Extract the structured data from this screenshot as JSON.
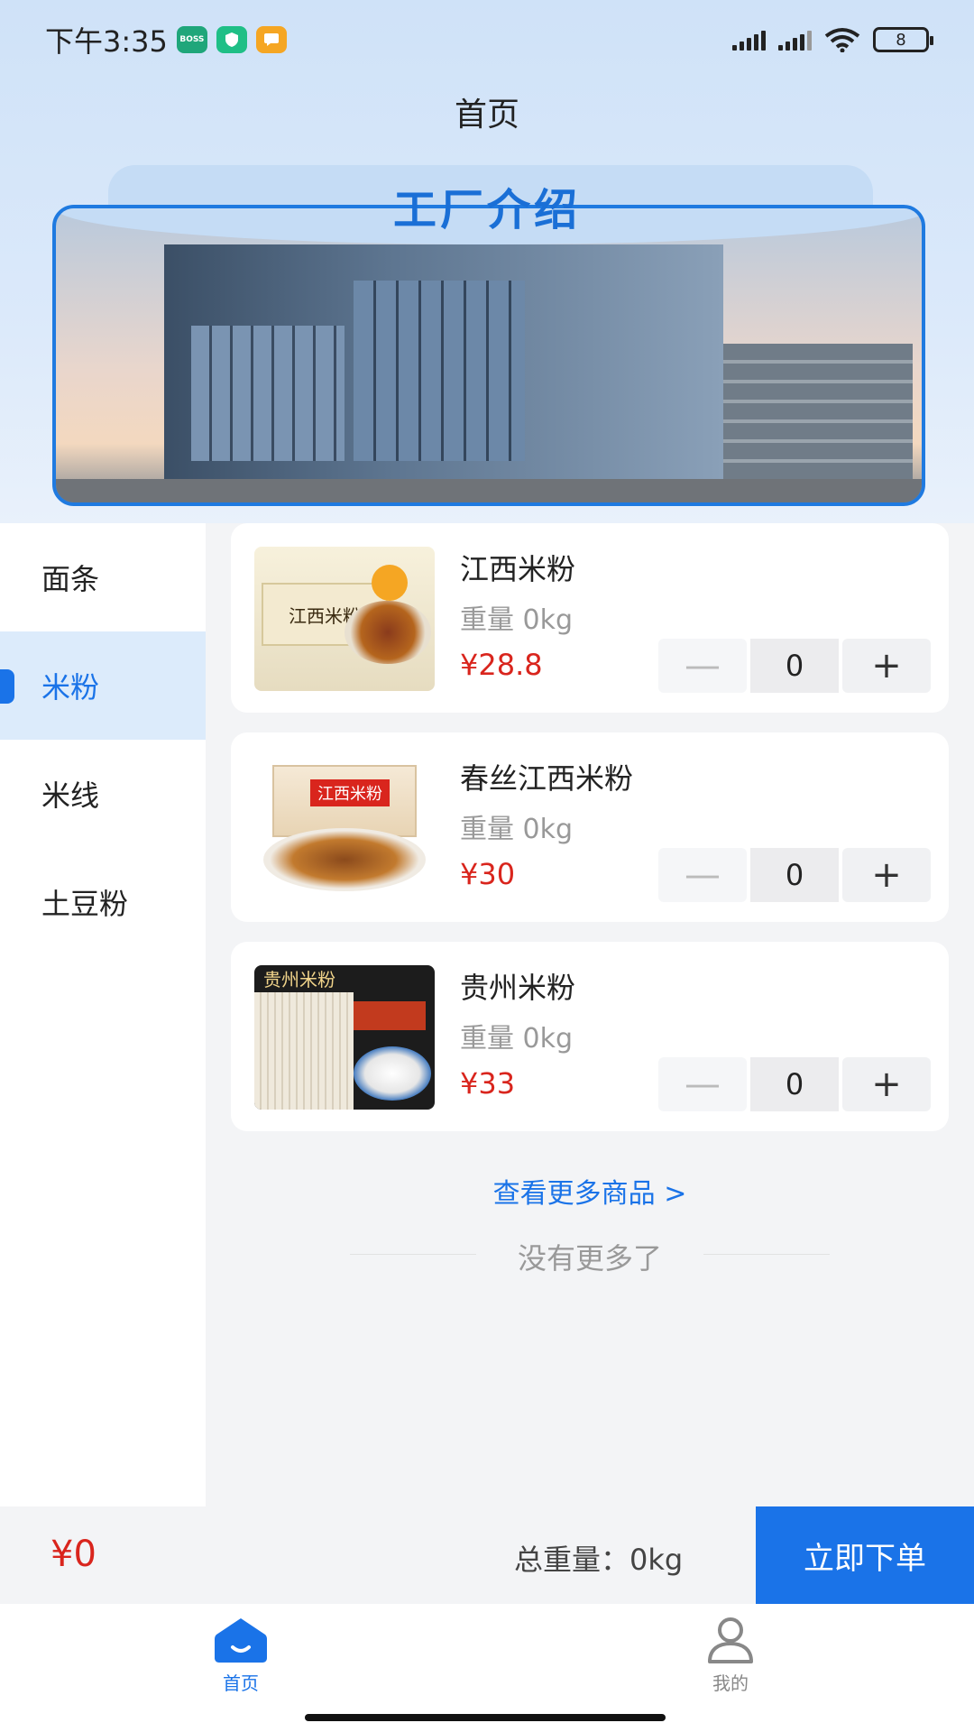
{
  "status_bar": {
    "time": "下午3:35",
    "app_badge": "BOSS\n直聘",
    "battery": "8"
  },
  "nav": {
    "title": "首页"
  },
  "banner": {
    "title": "工厂介绍"
  },
  "sidebar": {
    "items": [
      {
        "label": "面条",
        "active": false
      },
      {
        "label": "米粉",
        "active": true
      },
      {
        "label": "米线",
        "active": false
      },
      {
        "label": "土豆粉",
        "active": false
      }
    ]
  },
  "products": [
    {
      "name": "江西米粉",
      "weight": "重量 0kg",
      "price": "¥28.8",
      "qty": "0",
      "minus": "—",
      "plus": "+",
      "thumb_text": "江西米粉"
    },
    {
      "name": "春丝江西米粉",
      "weight": "重量 0kg",
      "price": "¥30",
      "qty": "0",
      "minus": "—",
      "plus": "+",
      "thumb_text": "江西米粉"
    },
    {
      "name": "贵州米粉",
      "weight": "重量 0kg",
      "price": "¥33",
      "qty": "0",
      "minus": "—",
      "plus": "+",
      "thumb_text": "贵州米粉"
    }
  ],
  "list_footer": {
    "see_more": "查看更多商品 >",
    "no_more": "没有更多了"
  },
  "order_bar": {
    "total_price": "¥0",
    "total_weight": "总重量：0kg",
    "submit": "立即下单"
  },
  "tabbar": {
    "tabs": [
      {
        "label": "首页",
        "icon": "home-icon",
        "active": true
      },
      {
        "label": "我的",
        "icon": "user-icon",
        "active": false
      }
    ]
  },
  "colors": {
    "accent": "#1a73e8",
    "price": "#d9251d"
  }
}
